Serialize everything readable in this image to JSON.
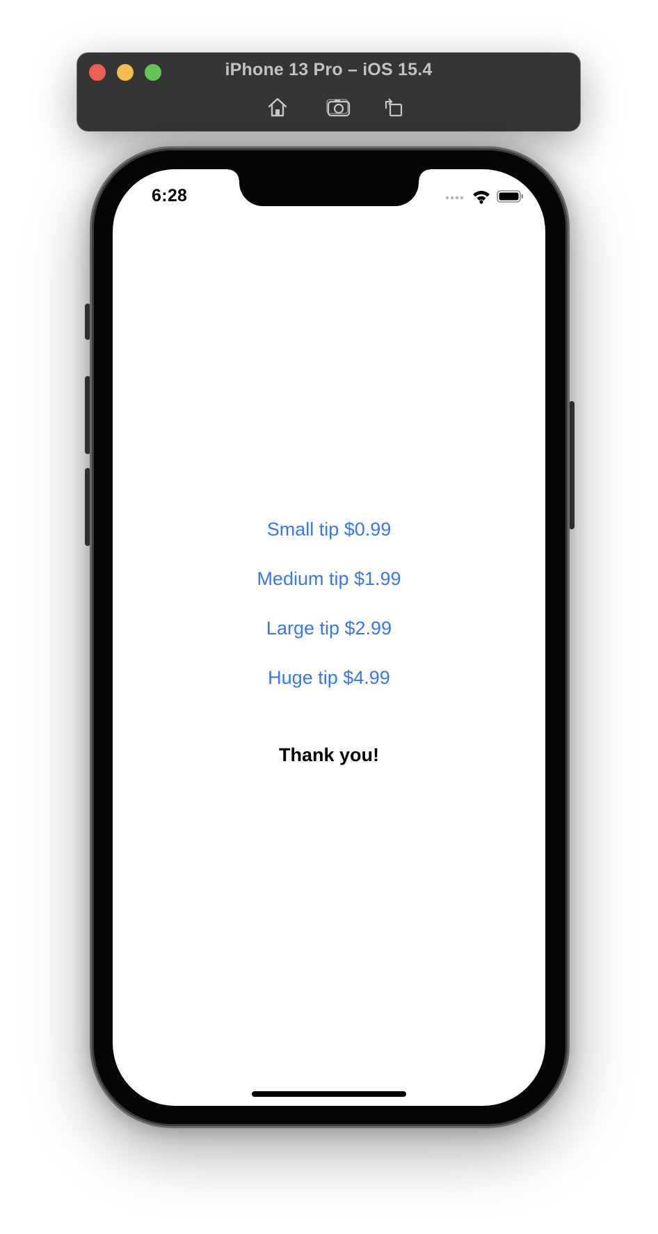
{
  "window": {
    "title": "iPhone 13 Pro – iOS 15.4",
    "toolbar": {
      "home_icon": "home-icon",
      "screenshot_icon": "camera-icon",
      "rotate_icon": "rotate-icon"
    }
  },
  "status_bar": {
    "time": "6:28",
    "signal_icon": "cellular-signal-icon",
    "wifi_icon": "wifi-icon",
    "battery_icon": "battery-icon"
  },
  "tips": [
    {
      "label": "Small tip $0.99"
    },
    {
      "label": "Medium tip $1.99"
    },
    {
      "label": "Large tip $2.99"
    },
    {
      "label": "Huge tip $4.99"
    }
  ],
  "message": "Thank you!",
  "colors": {
    "accent": "#3478f6",
    "toolbar_bg": "#353535",
    "close": "#ee5f57",
    "minimize": "#f4bd4f",
    "maximize": "#61c454"
  }
}
